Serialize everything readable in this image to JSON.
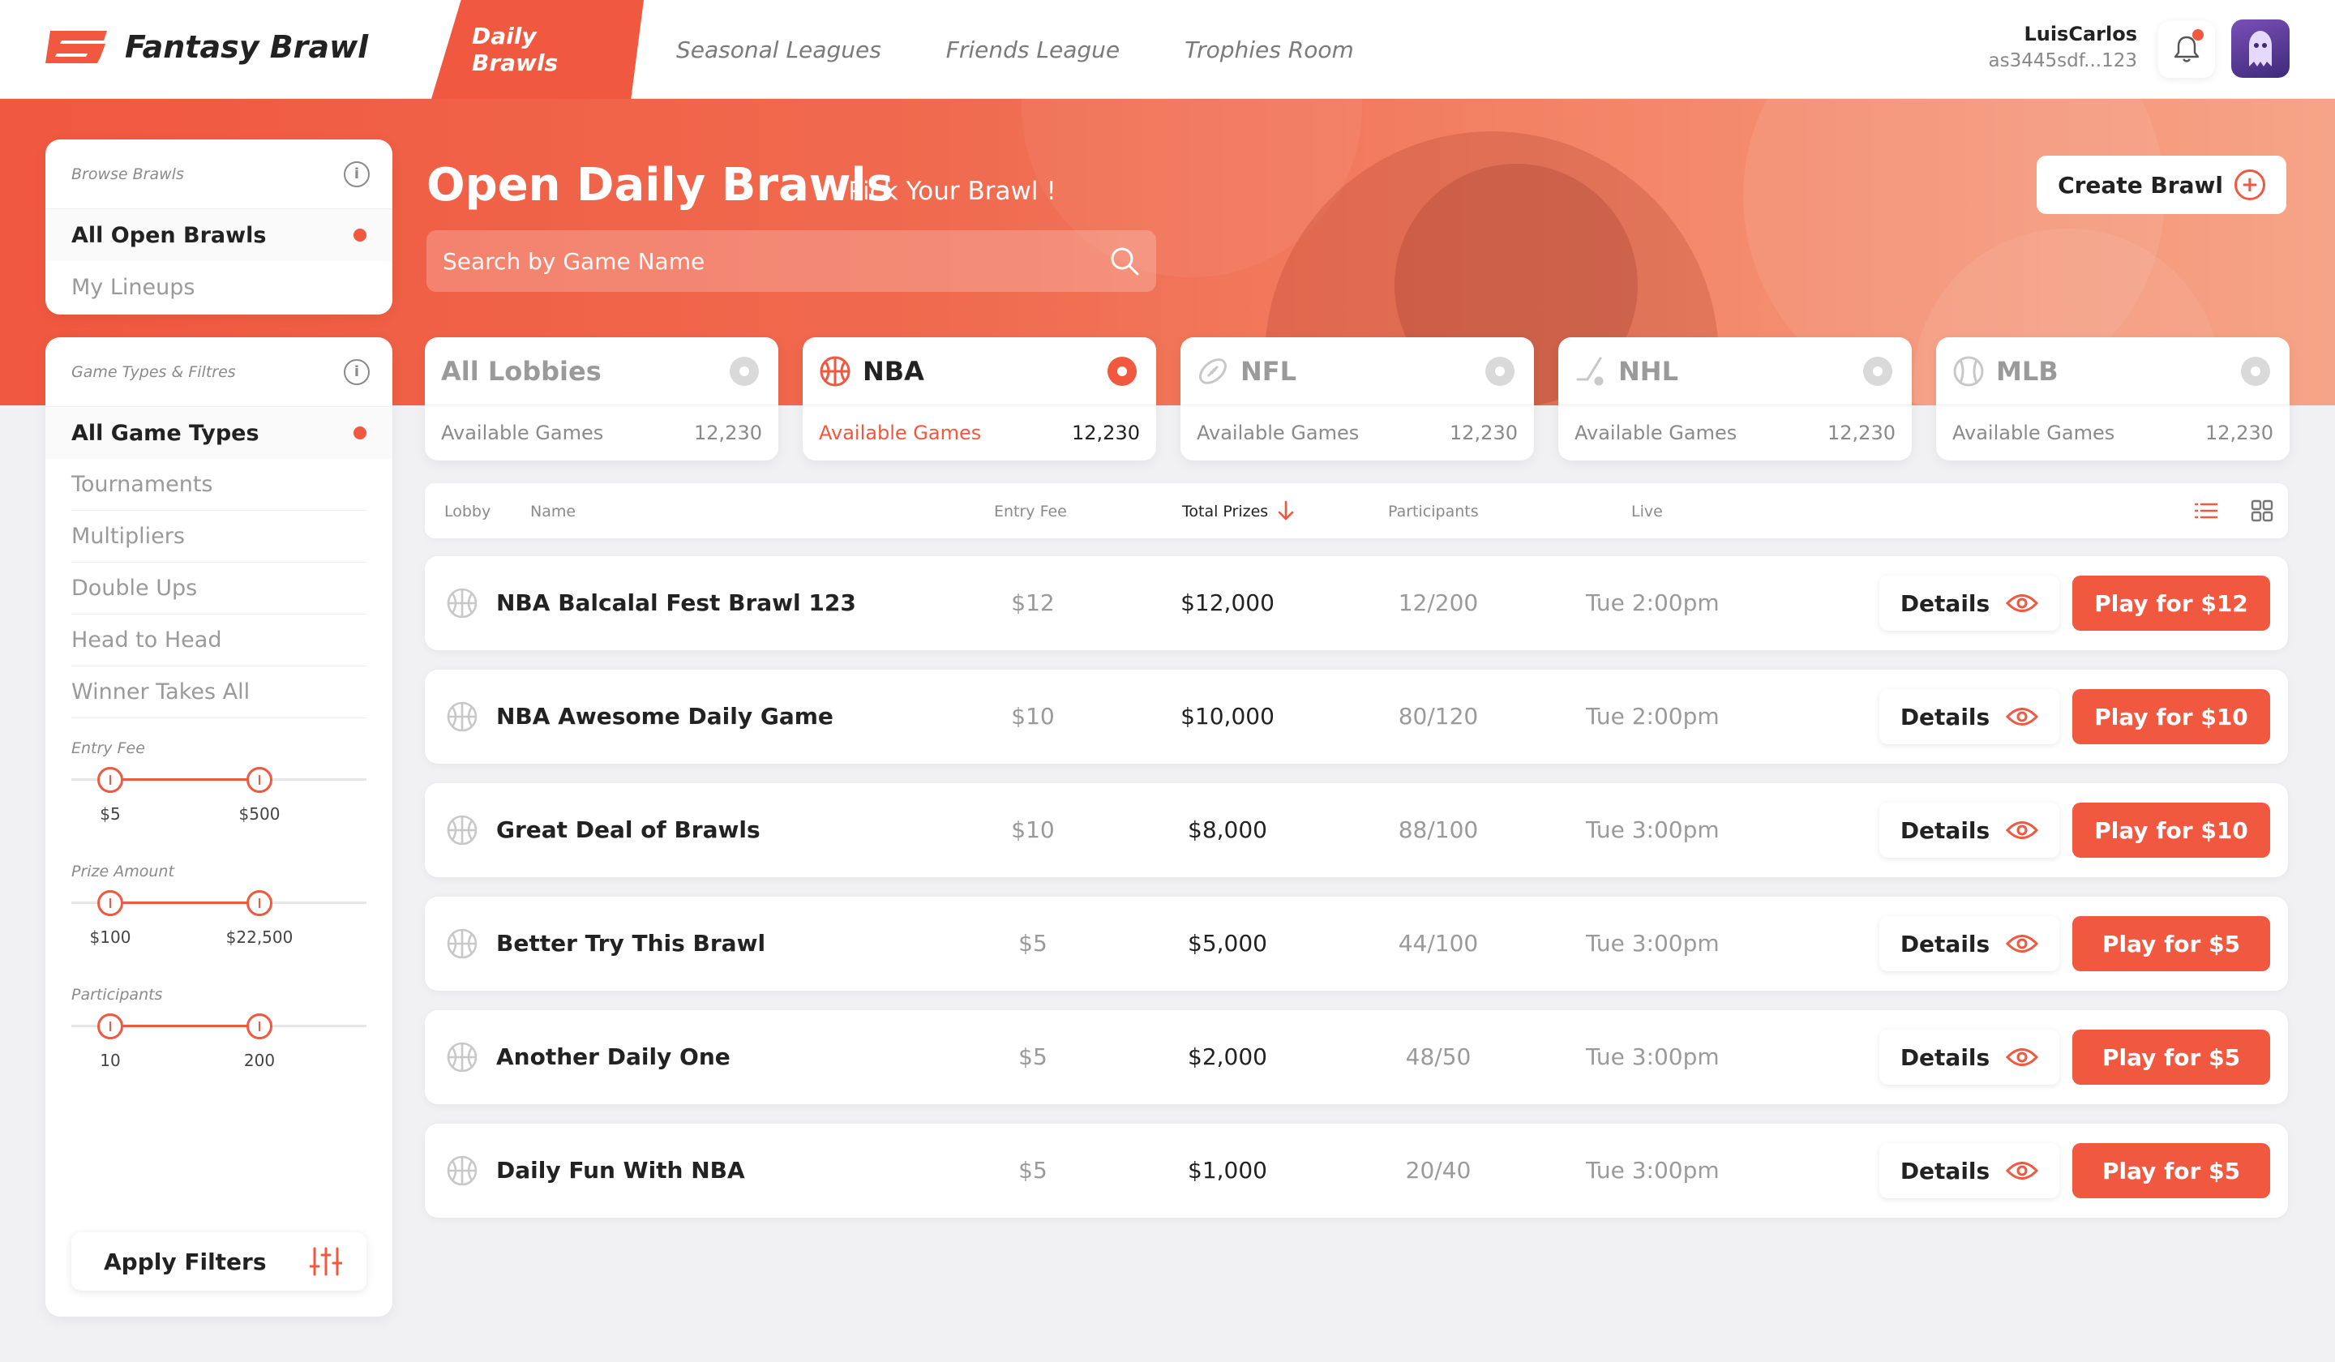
{
  "app": {
    "title": "Fantasy Brawl"
  },
  "nav": {
    "tabs": [
      "Daily Brawls",
      "Seasonal Leagues",
      "Friends League",
      "Trophies Room"
    ],
    "active": 0
  },
  "user": {
    "name": "LuisCarlos",
    "id": "as3445sdf...123"
  },
  "colors": {
    "accent": "#f0583f",
    "text": "#222222",
    "muted": "#9a9a9a"
  },
  "browse": {
    "title": "Browse Brawls",
    "items": [
      {
        "label": "All Open Brawls",
        "active": true
      },
      {
        "label": "My Lineups",
        "active": false
      }
    ]
  },
  "filters": {
    "title": "Game Types & Filtres",
    "types": [
      "All Game Types",
      "Tournaments",
      "Multipliers",
      "Double Ups",
      "Head to Head",
      "Winner Takes All"
    ],
    "entry_fee": {
      "label": "Entry Fee",
      "min": "$5",
      "max": "$500"
    },
    "prize_amount": {
      "label": "Prize Amount",
      "min": "$100",
      "max": "$22,500"
    },
    "participants": {
      "label": "Participants",
      "min": "10",
      "max": "200"
    },
    "apply_label": "Apply Filters"
  },
  "header": {
    "title": "Open Daily Brawls",
    "subtitle": "Pick Your Brawl !",
    "search_placeholder": "Search by Game Name",
    "create_label": "Create Brawl"
  },
  "leagues": [
    {
      "name": "All Lobbies",
      "label": "Available Games",
      "count": "12,230",
      "icon": "none",
      "active": false
    },
    {
      "name": "NBA",
      "label": "Available Games",
      "count": "12,230",
      "icon": "basketball-icon",
      "active": true
    },
    {
      "name": "NFL",
      "label": "Available Games",
      "count": "12,230",
      "icon": "football-icon",
      "active": false
    },
    {
      "name": "NHL",
      "label": "Available Games",
      "count": "12,230",
      "icon": "hockey-icon",
      "active": false
    },
    {
      "name": "MLB",
      "label": "Available Games",
      "count": "12,230",
      "icon": "baseball-icon",
      "active": false
    }
  ],
  "table": {
    "columns": {
      "lobby": "Lobby",
      "name": "Name",
      "entry": "Entry Fee",
      "prizes": "Total Prizes",
      "participants": "Participants",
      "live": "Live"
    },
    "details_label": "Details",
    "rows": [
      {
        "name": "NBA Balcalal Fest Brawl 123",
        "entry": "$12",
        "prize": "$12,000",
        "participants": "12/200",
        "live": "Tue 2:00pm",
        "play": "Play for $12"
      },
      {
        "name": "NBA Awesome Daily Game",
        "entry": "$10",
        "prize": "$10,000",
        "participants": "80/120",
        "live": "Tue 2:00pm",
        "play": "Play for $10"
      },
      {
        "name": "Great Deal of Brawls",
        "entry": "$10",
        "prize": "$8,000",
        "participants": "88/100",
        "live": "Tue 3:00pm",
        "play": "Play for $10"
      },
      {
        "name": "Better Try This Brawl",
        "entry": "$5",
        "prize": "$5,000",
        "participants": "44/100",
        "live": "Tue 3:00pm",
        "play": "Play for $5"
      },
      {
        "name": "Another Daily One",
        "entry": "$5",
        "prize": "$2,000",
        "participants": "48/50",
        "live": "Tue 3:00pm",
        "play": "Play for $5"
      },
      {
        "name": "Daily Fun With NBA",
        "entry": "$5",
        "prize": "$1,000",
        "participants": "20/40",
        "live": "Tue 3:00pm",
        "play": "Play for $5"
      }
    ]
  }
}
